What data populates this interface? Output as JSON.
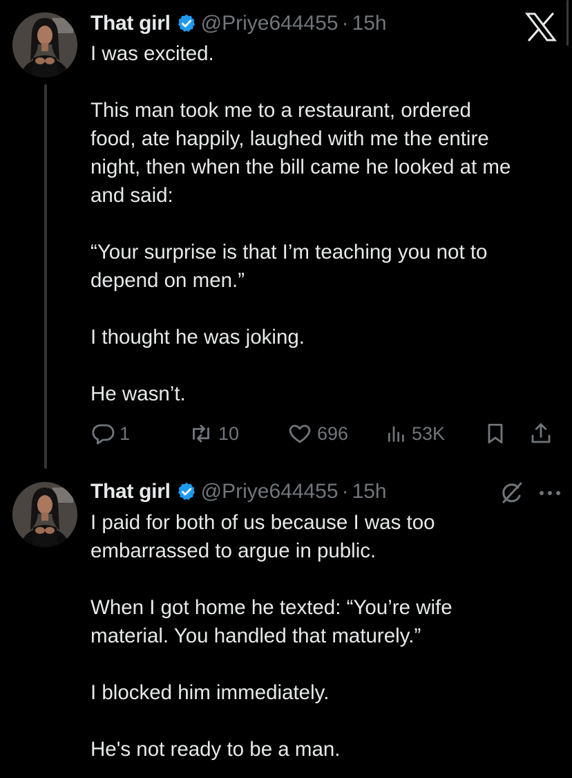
{
  "tweets": [
    {
      "name": "That girl",
      "handle": "@Priye644455",
      "separator": "·",
      "time": "15h",
      "lines": [
        "I was excited.",
        "",
        "This man took me to a restaurant, ordered",
        "food, ate happily, laughed with me the entire",
        "night, then when the bill came he looked at me",
        "and said:",
        "",
        "“Your surprise is that I’m teaching you not to",
        "depend on men.”",
        "",
        "I thought he was joking.",
        "",
        "He wasn’t."
      ],
      "stats": {
        "replies": "1",
        "reposts": "10",
        "likes": "696",
        "views": "53K"
      }
    },
    {
      "name": "That girl",
      "handle": "@Priye644455",
      "separator": "·",
      "time": "15h",
      "lines": [
        "I paid for both of us because I was too",
        "embarrassed to argue in public.",
        "",
        "When I got home he texted: “You’re wife",
        "material. You handled that maturely.”",
        "",
        "I blocked him immediately.",
        "",
        "He's not ready to be a man."
      ]
    }
  ],
  "icons": {
    "app_logo": "x-logo-icon",
    "verified": "verified-badge-icon",
    "reply": "reply-icon",
    "repost": "repost-icon",
    "like": "heart-icon",
    "views": "views-icon",
    "bookmark": "bookmark-icon",
    "share": "share-icon",
    "grok": "grok-icon",
    "more": "more-icon"
  },
  "colors": {
    "background": "#000000",
    "text": "#e7e9ea",
    "secondary_text": "#71767b",
    "verified_blue": "#1d9bf0",
    "thread_line": "#333639"
  }
}
